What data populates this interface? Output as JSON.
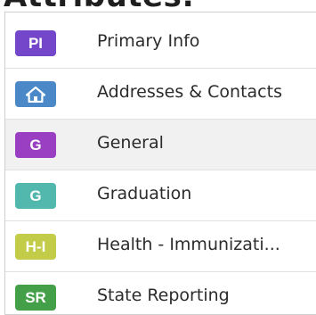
{
  "heading": "Attributes:",
  "menu": {
    "items": [
      {
        "badge": "PI",
        "badge_color": "#7446c9",
        "label": "Primary Info",
        "selected": false
      },
      {
        "badge": "",
        "badge_icon": "home-icon",
        "badge_color": "#4a88c8",
        "label": "Addresses & Contacts",
        "selected": false
      },
      {
        "badge": "G",
        "badge_color": "#9a3fc1",
        "label": "General",
        "selected": true
      },
      {
        "badge": "G",
        "badge_color": "#52b8ae",
        "label": "Graduation",
        "selected": false
      },
      {
        "badge": "H-I",
        "badge_color": "#c3cc48",
        "label": "Health - Immunizati...",
        "selected": false
      },
      {
        "badge": "SR",
        "badge_color": "#43a048",
        "label": "State Reporting",
        "selected": false
      }
    ]
  }
}
